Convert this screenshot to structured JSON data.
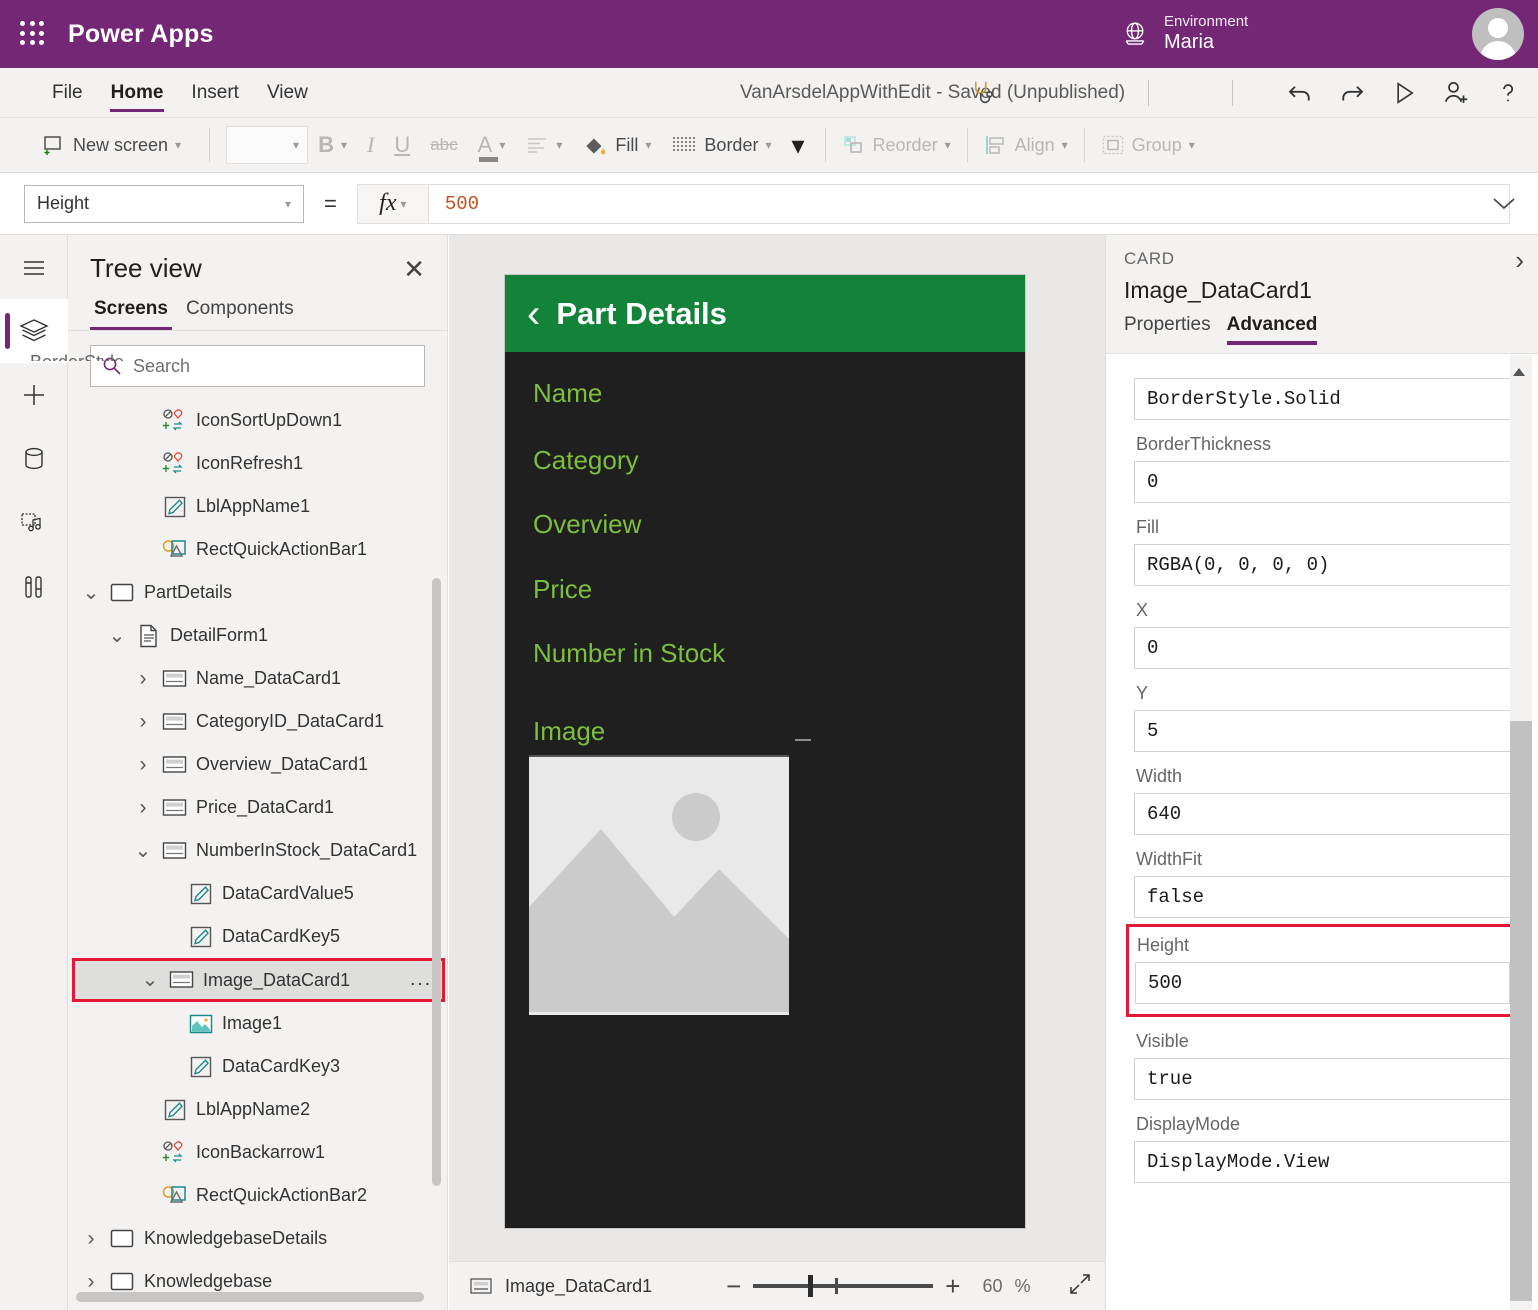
{
  "topbar": {
    "waffle_icon": "app-launcher-icon",
    "brand": "Power Apps",
    "globe_icon": "globe-icon",
    "environment_label": "Environment",
    "environment_name": "Maria",
    "avatar_icon": "user-avatar"
  },
  "menubar": {
    "items": [
      {
        "label": "File",
        "active": false
      },
      {
        "label": "Home",
        "active": true
      },
      {
        "label": "Insert",
        "active": false
      },
      {
        "label": "View",
        "active": false
      }
    ],
    "doc_title": "VanArsdelAppWithEdit - Saved (Unpublished)",
    "icons": [
      {
        "name": "app-checker-icon"
      },
      {
        "name": "undo-icon"
      },
      {
        "name": "redo-icon"
      },
      {
        "name": "play-preview-icon"
      },
      {
        "name": "share-user-icon"
      },
      {
        "name": "help-icon"
      }
    ]
  },
  "ribbon": {
    "new_screen": "New screen",
    "font_value": "",
    "bold": "B",
    "italic": "I",
    "underline": "U",
    "strikethrough": "abc",
    "font_color": "A",
    "align": "align-icon",
    "fill": "Fill",
    "border": "Border",
    "more": "more-chevron",
    "reorder": "Reorder",
    "align_group": "Align",
    "group": "Group"
  },
  "formulabar": {
    "property": "Height",
    "equals": "=",
    "fx": "fx",
    "value": "500",
    "expand_icon": "chevron-down-icon"
  },
  "rail": {
    "items": [
      {
        "name": "hamburger-menu-icon"
      },
      {
        "name": "tree-view-layers-icon",
        "active": true
      },
      {
        "name": "insert-plus-icon"
      },
      {
        "name": "data-cylinder-icon"
      },
      {
        "name": "media-icon"
      },
      {
        "name": "advanced-tools-icon"
      }
    ]
  },
  "treeview": {
    "title": "Tree view",
    "close_icon": "close-icon",
    "tabs": [
      {
        "label": "Screens",
        "active": true
      },
      {
        "label": "Components",
        "active": false
      }
    ],
    "search_placeholder": "Search",
    "search_icon": "search-icon",
    "nodes": [
      {
        "label": "IconSortUpDown1",
        "indent": 2,
        "twist": "",
        "icon": "icon-control-icon",
        "selected": false
      },
      {
        "label": "IconRefresh1",
        "indent": 2,
        "twist": "",
        "icon": "icon-control-icon",
        "selected": false
      },
      {
        "label": "LblAppName1",
        "indent": 2,
        "twist": "",
        "icon": "label-control-icon",
        "selected": false
      },
      {
        "label": "RectQuickActionBar1",
        "indent": 2,
        "twist": "",
        "icon": "shape-control-icon",
        "selected": false
      },
      {
        "label": "PartDetails",
        "indent": 0,
        "twist": "v",
        "icon": "screen-icon",
        "selected": false
      },
      {
        "label": "DetailForm1",
        "indent": 1,
        "twist": "v",
        "icon": "form-icon",
        "selected": false
      },
      {
        "label": "Name_DataCard1",
        "indent": 2,
        "twist": ">",
        "icon": "datacard-icon",
        "selected": false
      },
      {
        "label": "CategoryID_DataCard1",
        "indent": 2,
        "twist": ">",
        "icon": "datacard-icon",
        "selected": false
      },
      {
        "label": "Overview_DataCard1",
        "indent": 2,
        "twist": ">",
        "icon": "datacard-icon",
        "selected": false
      },
      {
        "label": "Price_DataCard1",
        "indent": 2,
        "twist": ">",
        "icon": "datacard-icon",
        "selected": false
      },
      {
        "label": "NumberInStock_DataCard1",
        "indent": 2,
        "twist": "v",
        "icon": "datacard-icon",
        "selected": false
      },
      {
        "label": "DataCardValue5",
        "indent": 3,
        "twist": "",
        "icon": "label-control-icon",
        "selected": false
      },
      {
        "label": "DataCardKey5",
        "indent": 3,
        "twist": "",
        "icon": "label-control-icon",
        "selected": false
      },
      {
        "label": "Image_DataCard1",
        "indent": 2,
        "twist": "v",
        "icon": "datacard-icon",
        "selected": true,
        "overflow": "..."
      },
      {
        "label": "Image1",
        "indent": 3,
        "twist": "",
        "icon": "image-control-icon",
        "selected": false
      },
      {
        "label": "DataCardKey3",
        "indent": 3,
        "twist": "",
        "icon": "label-control-icon",
        "selected": false
      },
      {
        "label": "LblAppName2",
        "indent": 2,
        "twist": "",
        "icon": "label-control-icon",
        "selected": false
      },
      {
        "label": "IconBackarrow1",
        "indent": 2,
        "twist": "",
        "icon": "icon-control-icon",
        "selected": false
      },
      {
        "label": "RectQuickActionBar2",
        "indent": 2,
        "twist": "",
        "icon": "shape-control-icon",
        "selected": false
      },
      {
        "label": "KnowledgebaseDetails",
        "indent": 0,
        "twist": ">",
        "icon": "screen-icon",
        "selected": false
      },
      {
        "label": "Knowledgebase",
        "indent": 0,
        "twist": ">",
        "icon": "screen-icon",
        "selected": false
      }
    ]
  },
  "canvas": {
    "app_header_title": "Part Details",
    "back_icon": "back-chevron-icon",
    "fields": [
      "Name",
      "Category",
      "Overview",
      "Price",
      "Number in Stock",
      "Image"
    ],
    "image_placeholder_icon": "image-placeholder-icon",
    "header_color": "#128338",
    "background_color": "#1f1f1f",
    "label_color": "#7dbe3e"
  },
  "statusbar": {
    "selection_icon": "datacard-icon",
    "selection_name": "Image_DataCard1",
    "zoom_out": "−",
    "zoom_in": "+",
    "zoom_value": "60",
    "zoom_unit": "%",
    "fit_icon": "fit-to-screen-icon"
  },
  "properties": {
    "kind": "CARD",
    "name": "Image_DataCard1",
    "collapse_icon": "chevron-right-icon",
    "tabs": [
      {
        "label": "Properties",
        "active": false
      },
      {
        "label": "Advanced",
        "active": true
      }
    ],
    "cut_off_label": "BorderStyle",
    "fields": [
      {
        "label": "",
        "value": "BorderStyle.Solid",
        "highlight": false
      },
      {
        "label": "BorderThickness",
        "value": "0",
        "highlight": false
      },
      {
        "label": "Fill",
        "value": "RGBA(0, 0, 0, 0)",
        "highlight": false
      },
      {
        "label": "X",
        "value": "0",
        "highlight": false
      },
      {
        "label": "Y",
        "value": "5",
        "highlight": false
      },
      {
        "label": "Width",
        "value": "640",
        "highlight": false
      },
      {
        "label": "WidthFit",
        "value": "false",
        "highlight": false
      },
      {
        "label": "Height",
        "value": "500",
        "highlight": true
      },
      {
        "label": "Visible",
        "value": "true",
        "highlight": false
      },
      {
        "label": "DisplayMode",
        "value": "DisplayMode.View",
        "highlight": false
      }
    ]
  }
}
